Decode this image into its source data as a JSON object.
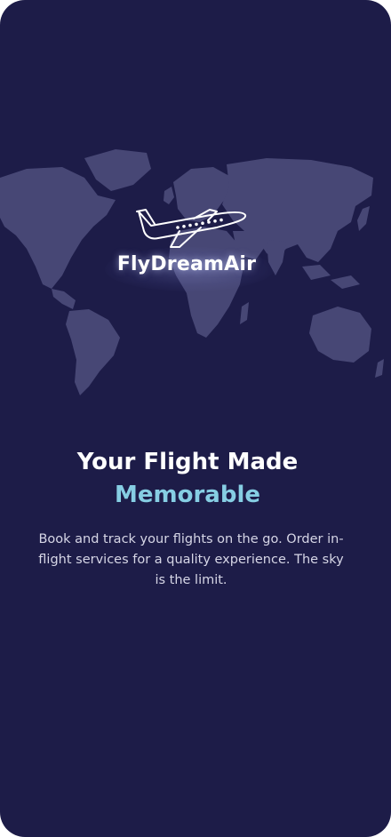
{
  "brand": {
    "name": "FlyDreamAir"
  },
  "hero": {
    "title_line1": "Your Flight Made",
    "title_line2": "Memorable",
    "description": "Book and track your flights on the go. Order in-flight services for a quality experience. The sky is the limit."
  },
  "colors": {
    "background": "#1d1c48",
    "accent": "#86cee3",
    "map": "#4a4a78",
    "text": "#ffffff"
  },
  "icons": {
    "logo": "airplane-icon",
    "background": "world-map"
  }
}
